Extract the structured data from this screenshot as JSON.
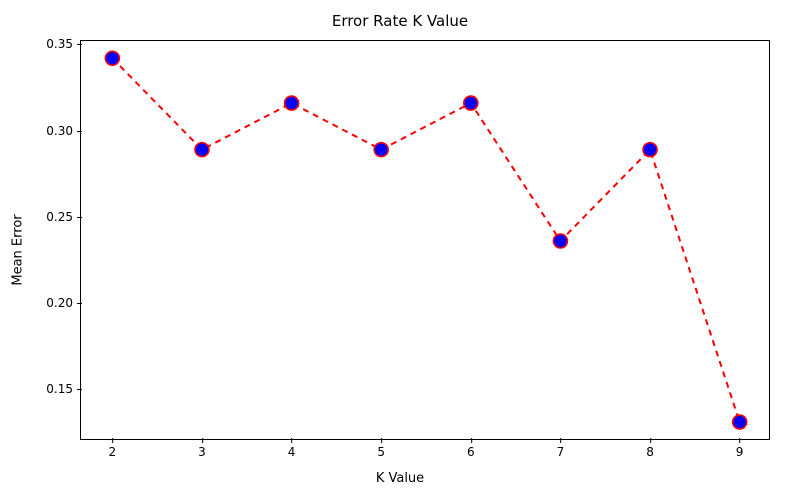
{
  "chart_data": {
    "type": "line",
    "title": "Error Rate K Value",
    "xlabel": "K Value",
    "ylabel": "Mean Error",
    "x": [
      2,
      3,
      4,
      5,
      6,
      7,
      8,
      9
    ],
    "values": [
      0.342,
      0.289,
      0.316,
      0.289,
      0.316,
      0.236,
      0.289,
      0.131
    ],
    "xlim": [
      1.65,
      9.35
    ],
    "ylim": [
      0.12,
      0.352
    ],
    "xticks": [
      2,
      3,
      4,
      5,
      6,
      7,
      8,
      9
    ],
    "yticks": [
      0.15,
      0.2,
      0.25,
      0.3,
      0.35
    ],
    "ytick_labels": [
      "0.15",
      "0.20",
      "0.25",
      "0.30",
      "0.35"
    ],
    "line_color": "#ff0000",
    "line_dash": "6,5",
    "marker_fill": "#0000ff",
    "marker_edge": "#ff0000",
    "marker_radius": 7
  }
}
